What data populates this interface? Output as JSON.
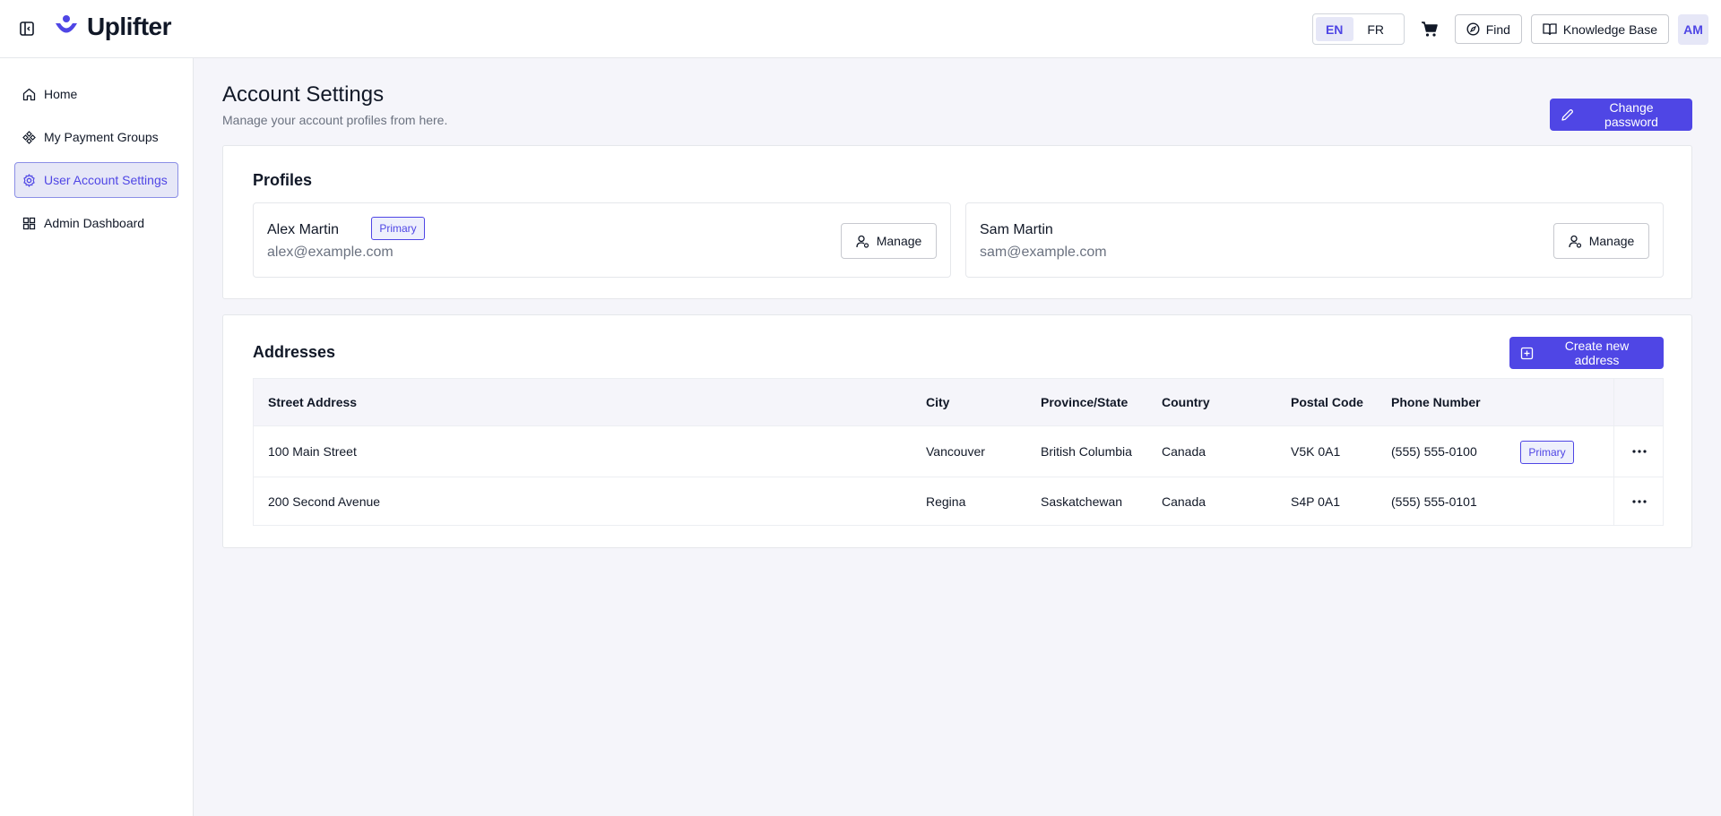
{
  "brand": {
    "name": "Uplifter",
    "color": "#4f46e5"
  },
  "header": {
    "lang_en": "EN",
    "lang_fr": "FR",
    "active_lang": "EN",
    "find_label": "Find",
    "kb_label": "Knowledge Base",
    "avatar_initials": "AM"
  },
  "sidebar": {
    "items": [
      {
        "label": "Home",
        "icon": "home-icon",
        "active": false
      },
      {
        "label": "My Payment Groups",
        "icon": "payment-groups-icon",
        "active": false
      },
      {
        "label": "User Account Settings",
        "icon": "gear-icon",
        "active": true
      },
      {
        "label": "Admin Dashboard",
        "icon": "dashboard-grid-icon",
        "active": false
      }
    ]
  },
  "page": {
    "title": "Account Settings",
    "subtitle": "Manage your account profiles from here.",
    "change_password_label": "Change password"
  },
  "profiles": {
    "title": "Profiles",
    "items": [
      {
        "name": "Alex Martin",
        "email": "alex@example.com",
        "badge": "Primary",
        "manage_label": "Manage"
      },
      {
        "name": "Sam Martin",
        "email": "sam@example.com",
        "manage_label": "Manage"
      }
    ]
  },
  "addresses": {
    "title": "Addresses",
    "create_label": "Create new address",
    "columns": [
      "Street Address",
      "City",
      "Province/State",
      "Country",
      "Postal Code",
      "Phone Number"
    ],
    "rows": [
      {
        "street": "100 Main Street",
        "city": "Vancouver",
        "province": "British Columbia",
        "country": "Canada",
        "postal": "V5K 0A1",
        "phone": "(555) 555-0100",
        "badge": "Primary"
      },
      {
        "street": "200 Second Avenue",
        "city": "Regina",
        "province": "Saskatchewan",
        "country": "Canada",
        "postal": "S4P 0A1",
        "phone": "(555) 555-0101"
      }
    ]
  }
}
